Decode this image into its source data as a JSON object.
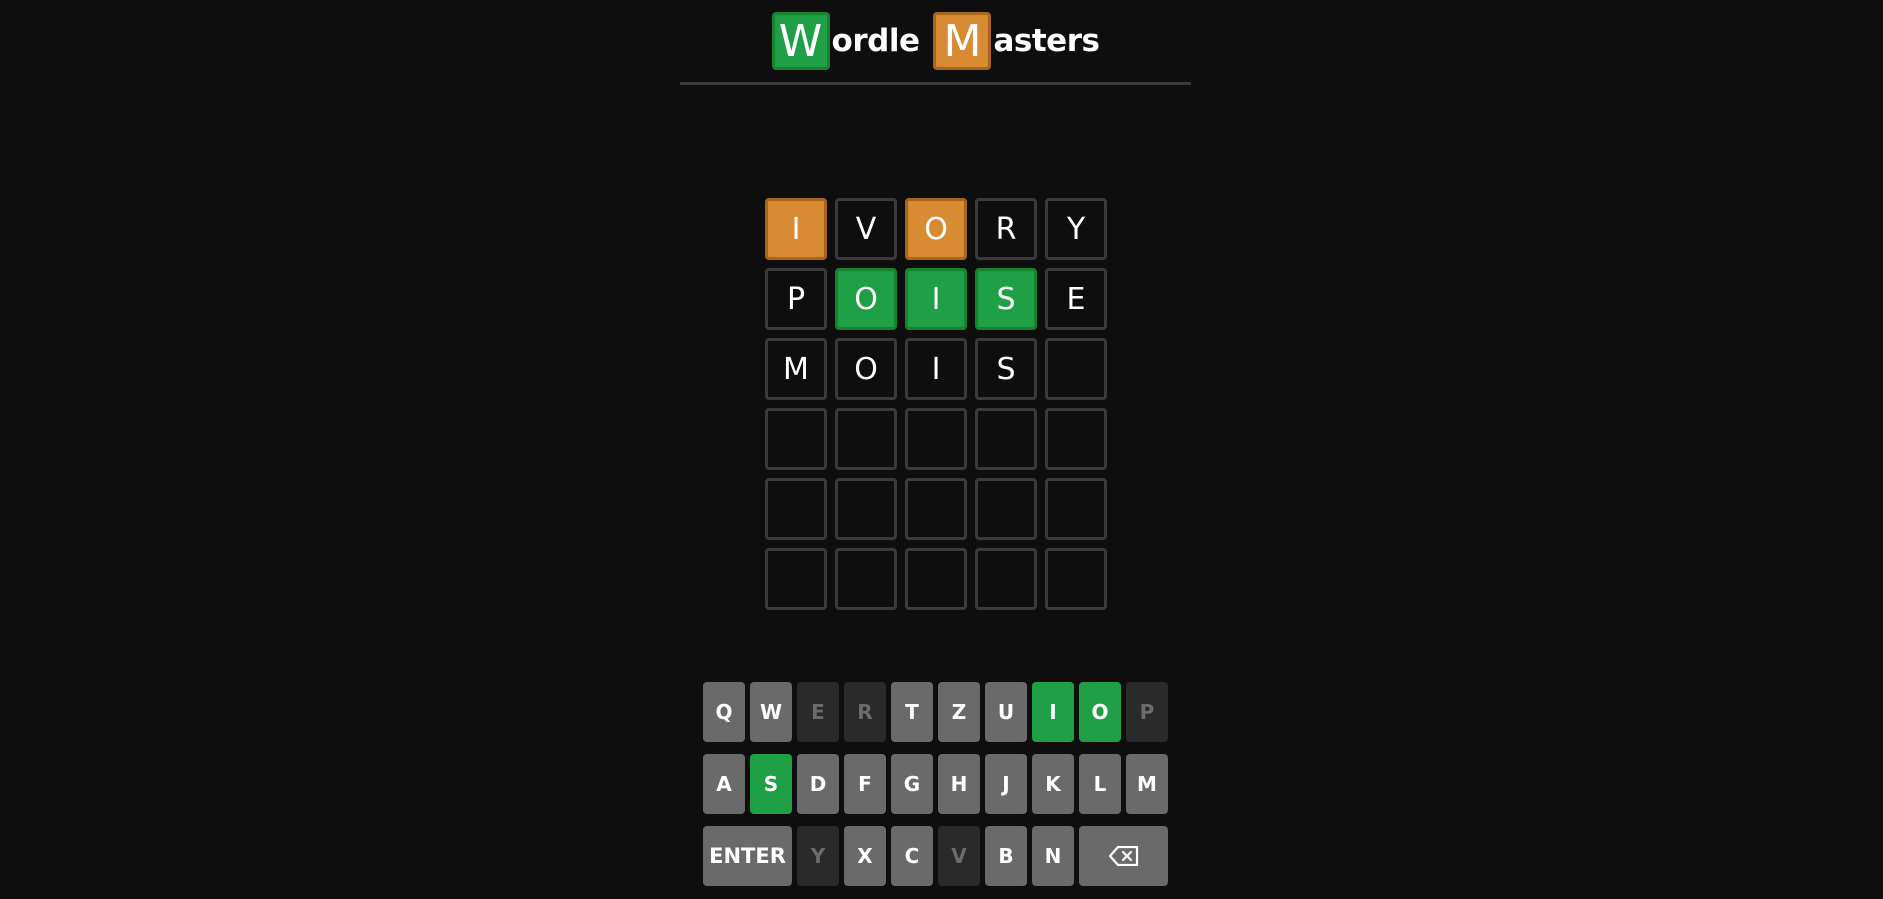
{
  "header": {
    "logo": [
      {
        "first": "W",
        "rest": "ordle",
        "color": "#1fa046"
      },
      {
        "first": "M",
        "rest": "asters",
        "color": "#d98b34"
      }
    ]
  },
  "board": {
    "rows": [
      [
        {
          "letter": "I",
          "state": "present"
        },
        {
          "letter": "V",
          "state": "empty"
        },
        {
          "letter": "O",
          "state": "present"
        },
        {
          "letter": "R",
          "state": "empty"
        },
        {
          "letter": "Y",
          "state": "empty"
        }
      ],
      [
        {
          "letter": "P",
          "state": "empty"
        },
        {
          "letter": "O",
          "state": "correct"
        },
        {
          "letter": "I",
          "state": "correct"
        },
        {
          "letter": "S",
          "state": "correct"
        },
        {
          "letter": "E",
          "state": "empty"
        }
      ],
      [
        {
          "letter": "M",
          "state": "empty"
        },
        {
          "letter": "O",
          "state": "empty"
        },
        {
          "letter": "I",
          "state": "empty"
        },
        {
          "letter": "S",
          "state": "empty"
        },
        {
          "letter": "",
          "state": "empty"
        }
      ],
      [
        {
          "letter": "",
          "state": "empty"
        },
        {
          "letter": "",
          "state": "empty"
        },
        {
          "letter": "",
          "state": "empty"
        },
        {
          "letter": "",
          "state": "empty"
        },
        {
          "letter": "",
          "state": "empty"
        }
      ],
      [
        {
          "letter": "",
          "state": "empty"
        },
        {
          "letter": "",
          "state": "empty"
        },
        {
          "letter": "",
          "state": "empty"
        },
        {
          "letter": "",
          "state": "empty"
        },
        {
          "letter": "",
          "state": "empty"
        }
      ],
      [
        {
          "letter": "",
          "state": "empty"
        },
        {
          "letter": "",
          "state": "empty"
        },
        {
          "letter": "",
          "state": "empty"
        },
        {
          "letter": "",
          "state": "empty"
        },
        {
          "letter": "",
          "state": "empty"
        }
      ]
    ]
  },
  "keyboard": {
    "rows": [
      [
        {
          "label": "Q",
          "state": "unused"
        },
        {
          "label": "W",
          "state": "unused"
        },
        {
          "label": "E",
          "state": "absent"
        },
        {
          "label": "R",
          "state": "absent"
        },
        {
          "label": "T",
          "state": "unused"
        },
        {
          "label": "Z",
          "state": "unused"
        },
        {
          "label": "U",
          "state": "unused"
        },
        {
          "label": "I",
          "state": "correct"
        },
        {
          "label": "O",
          "state": "correct"
        },
        {
          "label": "P",
          "state": "absent"
        }
      ],
      [
        {
          "label": "A",
          "state": "unused"
        },
        {
          "label": "S",
          "state": "correct"
        },
        {
          "label": "D",
          "state": "unused"
        },
        {
          "label": "F",
          "state": "unused"
        },
        {
          "label": "G",
          "state": "unused"
        },
        {
          "label": "H",
          "state": "unused"
        },
        {
          "label": "J",
          "state": "unused"
        },
        {
          "label": "K",
          "state": "unused"
        },
        {
          "label": "L",
          "state": "unused"
        },
        {
          "label": "M",
          "state": "unused"
        }
      ],
      [
        {
          "label": "ENTER",
          "state": "unused",
          "wide": true
        },
        {
          "label": "Y",
          "state": "absent"
        },
        {
          "label": "X",
          "state": "unused"
        },
        {
          "label": "C",
          "state": "unused"
        },
        {
          "label": "V",
          "state": "absent"
        },
        {
          "label": "B",
          "state": "unused"
        },
        {
          "label": "N",
          "state": "unused"
        },
        {
          "label": "",
          "state": "unused",
          "wide": true,
          "icon": "backspace-icon"
        }
      ]
    ]
  },
  "colors": {
    "correct": "#1fa046",
    "present": "#d98b34",
    "absent_key": "#2a2a2a",
    "unused_key": "#6a6a6a",
    "background": "#0e0e0e"
  }
}
